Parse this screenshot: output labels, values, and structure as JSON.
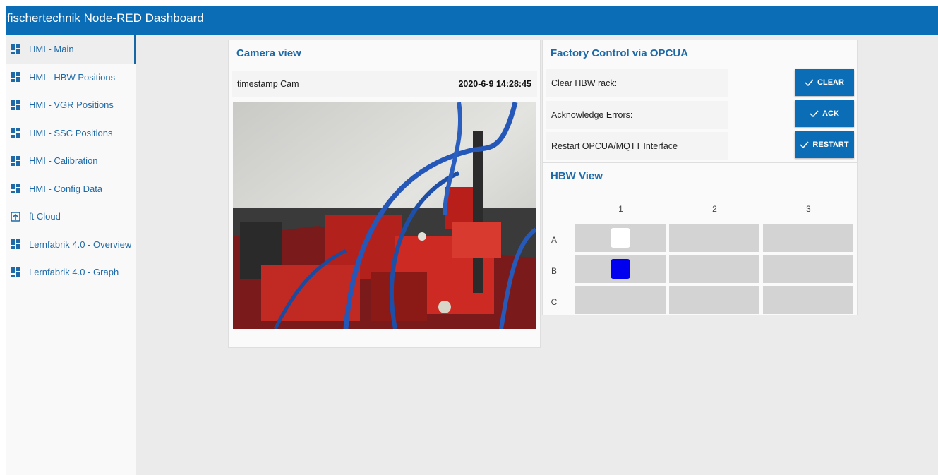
{
  "header": {
    "title": "fischertechnik Node-RED Dashboard"
  },
  "sidebar": {
    "items": [
      {
        "label": "HMI - Main",
        "icon": "dashboard-icon",
        "active": true
      },
      {
        "label": "HMI - HBW Positions",
        "icon": "dashboard-icon"
      },
      {
        "label": "HMI - VGR Positions",
        "icon": "dashboard-icon"
      },
      {
        "label": "HMI - SSC Positions",
        "icon": "dashboard-icon"
      },
      {
        "label": "HMI - Calibration",
        "icon": "dashboard-icon"
      },
      {
        "label": "HMI - Config Data",
        "icon": "dashboard-icon"
      },
      {
        "label": "ft Cloud",
        "icon": "external-link-icon"
      },
      {
        "label": "Lernfabrik 4.0 - Overview",
        "icon": "dashboard-icon"
      },
      {
        "label": "Lernfabrik 4.0 - Graph",
        "icon": "dashboard-icon"
      }
    ]
  },
  "camera": {
    "title": "Camera view",
    "timestamp_label": "timestamp Cam",
    "timestamp_value": "2020-6-9 14:28:45"
  },
  "factory": {
    "title": "Factory Control via OPCUA",
    "rows": [
      {
        "label": "Clear HBW rack:",
        "button": "CLEAR"
      },
      {
        "label": "Acknowledge Errors:",
        "button": "ACK"
      },
      {
        "label": "Restart OPCUA/MQTT Interface",
        "button": "RESTART"
      }
    ]
  },
  "hbw": {
    "title": "HBW View",
    "columns": [
      "1",
      "2",
      "3"
    ],
    "rows": [
      "A",
      "B",
      "C"
    ],
    "slots": [
      [
        "white",
        "",
        ""
      ],
      [
        "blue",
        "",
        ""
      ],
      [
        "",
        "",
        ""
      ]
    ]
  },
  "colors": {
    "accent": "#0a6db5",
    "slot_white": "#ffffff",
    "slot_blue": "#0000ee",
    "cell": "#d3d3d3"
  }
}
